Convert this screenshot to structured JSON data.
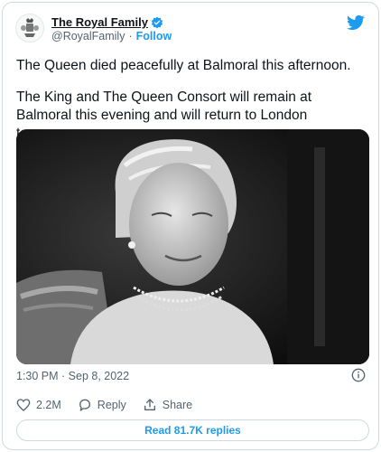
{
  "account": {
    "display_name": "The Royal Family",
    "handle": "@RoyalFamily",
    "separator": "·",
    "follow_label": "Follow",
    "avatar_icon": "royal-coat-of-arms-icon"
  },
  "tweet": {
    "paragraph_1": "The Queen died peacefully at Balmoral this afternoon.",
    "paragraph_2": "The King and The Queen Consort will remain at Balmoral this evening and will return to London tomorrow.",
    "photo_icon": "queen-portrait-photo",
    "timestamp": "1:30 PM · Sep 8, 2022"
  },
  "actions": {
    "likes_count": "2.2M",
    "reply_label": "Reply",
    "share_label": "Share"
  },
  "replies_button_label": "Read 81.7K replies",
  "colors": {
    "accent": "#1d9bf0",
    "text": "#0f1419",
    "muted": "#536471",
    "border": "#cfd9de"
  }
}
